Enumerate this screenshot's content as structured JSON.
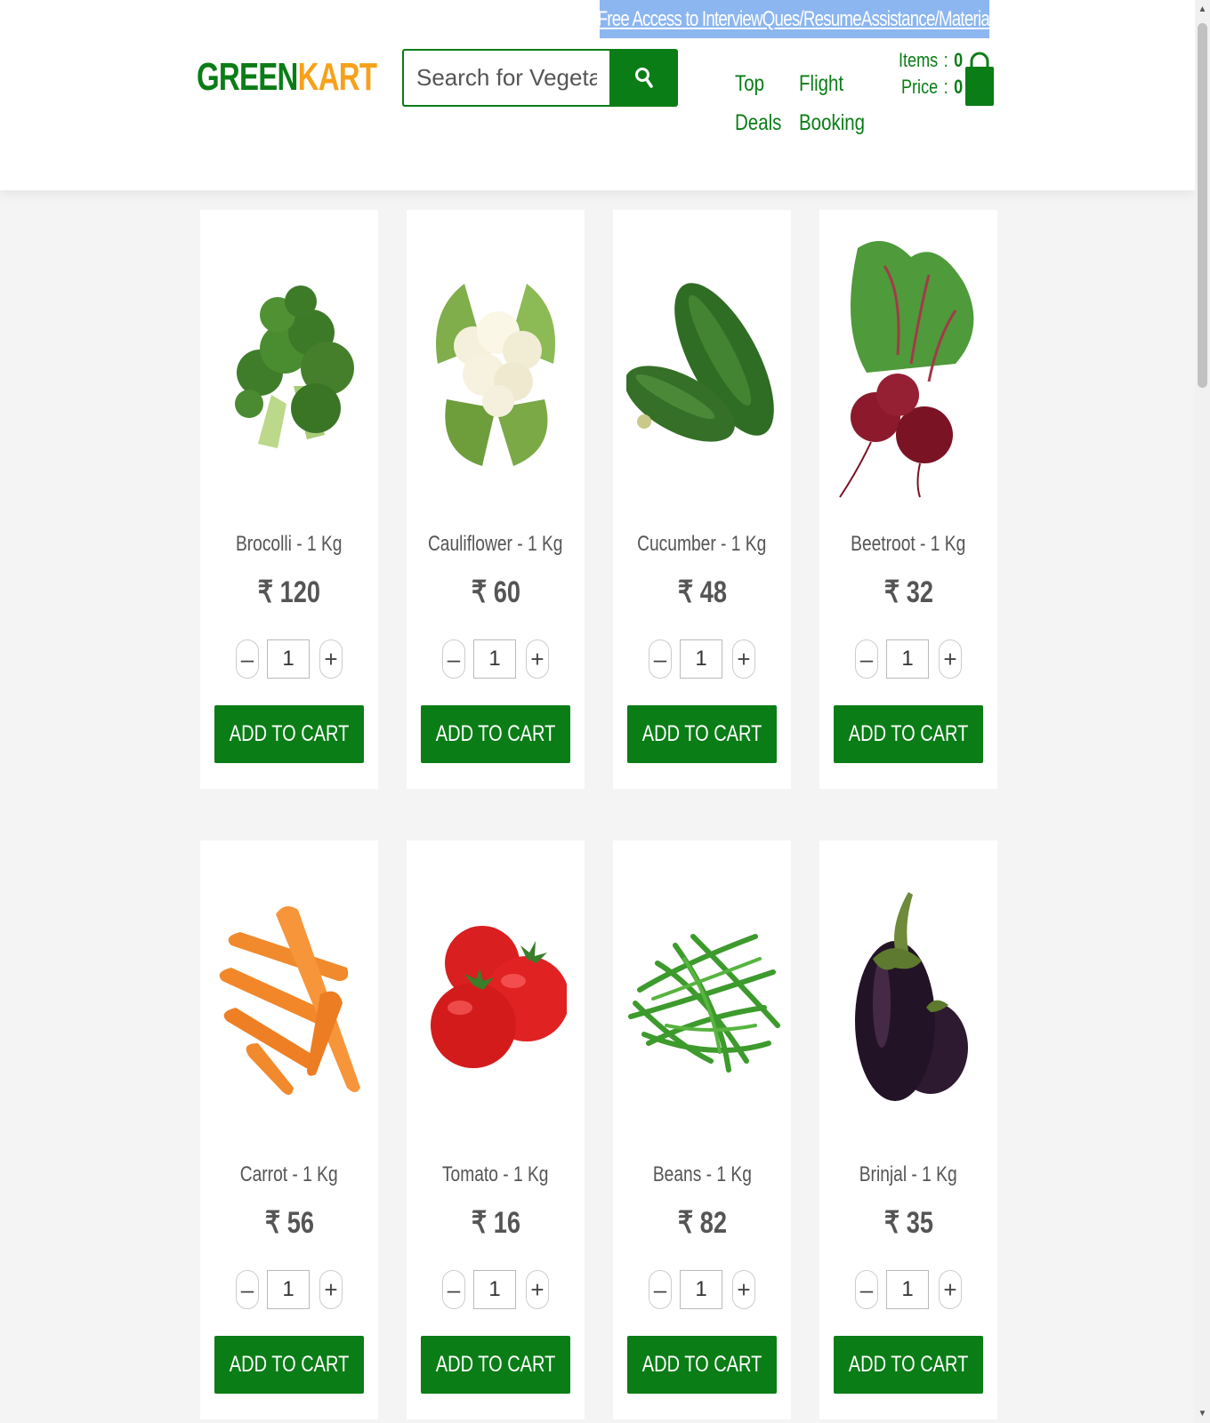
{
  "promo": {
    "text": "Free Access to InterviewQues/ResumeAssistance/Material"
  },
  "logo": {
    "part1": "GREEN",
    "part2": "KART"
  },
  "search": {
    "placeholder": "Search for Vegetables and Fruits"
  },
  "nav": {
    "top_deals": [
      "Top",
      "Deals"
    ],
    "flight_booking": [
      "Flight",
      "Booking"
    ]
  },
  "cart": {
    "items_label": "Items",
    "items_value": "0",
    "price_label": "Price",
    "price_value": "0",
    "separator": ":"
  },
  "colors": {
    "brand_green": "#0a7d16",
    "brand_orange": "#f7a11a",
    "promo_bg": "#8cb6f0"
  },
  "products": [
    {
      "name": "Brocolli - 1 Kg",
      "price": "₹ 120",
      "qty": "1",
      "button": "ADD TO CART",
      "icon": "broccoli-image"
    },
    {
      "name": "Cauliflower - 1 Kg",
      "price": "₹ 60",
      "qty": "1",
      "button": "ADD TO CART",
      "icon": "cauliflower-image"
    },
    {
      "name": "Cucumber - 1 Kg",
      "price": "₹ 48",
      "qty": "1",
      "button": "ADD TO CART",
      "icon": "cucumber-image"
    },
    {
      "name": "Beetroot - 1 Kg",
      "price": "₹ 32",
      "qty": "1",
      "button": "ADD TO CART",
      "icon": "beetroot-image"
    },
    {
      "name": "Carrot - 1 Kg",
      "price": "₹ 56",
      "qty": "1",
      "button": "ADD TO CART",
      "icon": "carrot-image"
    },
    {
      "name": "Tomato - 1 Kg",
      "price": "₹ 16",
      "qty": "1",
      "button": "ADD TO CART",
      "icon": "tomato-image"
    },
    {
      "name": "Beans - 1 Kg",
      "price": "₹ 82",
      "qty": "1",
      "button": "ADD TO CART",
      "icon": "beans-image"
    },
    {
      "name": "Brinjal - 1 Kg",
      "price": "₹ 35",
      "qty": "1",
      "button": "ADD TO CART",
      "icon": "brinjal-image"
    }
  ],
  "stepper": {
    "decrement": "–",
    "increment": "+"
  }
}
